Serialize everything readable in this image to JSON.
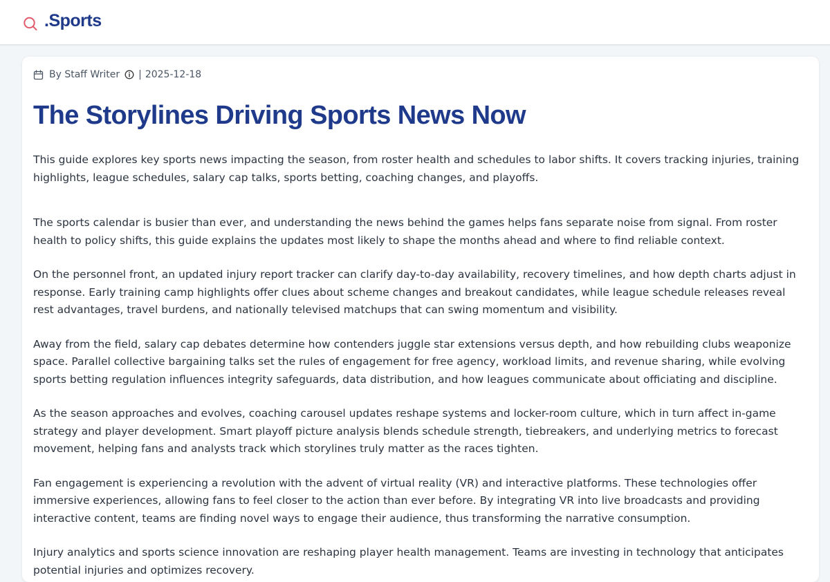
{
  "header": {
    "brand": ".Sports",
    "search_icon": "search-icon",
    "accent_color": "#e05a6b",
    "brand_color": "#1f3a8a"
  },
  "article": {
    "byline": "By Staff Writer",
    "separator": "|",
    "date": "2025-12-18",
    "calendar_icon": "calendar-icon",
    "info_icon": "info-icon",
    "title": "The Storylines Driving Sports News Now",
    "summary": "This guide explores key sports news impacting the season, from roster health and schedules to labor shifts. It covers tracking injuries, training highlights, league schedules, salary cap talks, sports betting, coaching changes, and playoffs.",
    "paragraphs": [
      "The sports calendar is busier than ever, and understanding the news behind the games helps fans separate noise from signal. From roster health to policy shifts, this guide explains the updates most likely to shape the months ahead and where to find reliable context.",
      "On the personnel front, an updated injury report tracker can clarify day-to-day availability, recovery timelines, and how depth charts adjust in response. Early training camp highlights offer clues about scheme changes and breakout candidates, while league schedule releases reveal rest advantages, travel burdens, and nationally televised matchups that can swing momentum and visibility.",
      "Away from the field, salary cap debates determine how contenders juggle star extensions versus depth, and how rebuilding clubs weaponize space. Parallel collective bargaining talks set the rules of engagement for free agency, workload limits, and revenue sharing, while evolving sports betting regulation influences integrity safeguards, data distribution, and how leagues communicate about officiating and discipline.",
      "As the season approaches and evolves, coaching carousel updates reshape systems and locker-room culture, which in turn affect in-game strategy and player development. Smart playoff picture analysis blends schedule strength, tiebreakers, and underlying metrics to forecast movement, helping fans and analysts track which storylines truly matter as the races tighten.",
      "Fan engagement is experiencing a revolution with the advent of virtual reality (VR) and interactive platforms. These technologies offer immersive experiences, allowing fans to feel closer to the action than ever before. By integrating VR into live broadcasts and providing interactive content, teams are finding novel ways to engage their audience, thus transforming the narrative consumption.",
      "Injury analytics and sports science innovation are reshaping player health management. Teams are investing in technology that anticipates potential injuries and optimizes recovery."
    ]
  }
}
